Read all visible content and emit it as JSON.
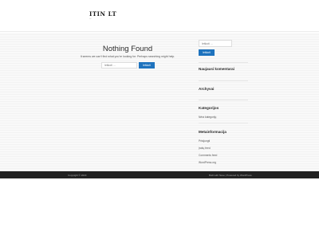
{
  "site": {
    "title": "ITIN LT",
    "tagline": "—"
  },
  "main": {
    "title": "Nothing Found",
    "message": "It seems we can't find what you're looking for. Perhaps searching might help.",
    "search_placeholder": "Ieškoti …",
    "search_button": "Ieškoti"
  },
  "sidebar": {
    "search_placeholder": "Ieškoti …",
    "search_button": "Ieškoti",
    "recent_comments_title": "Naujausi komentarai",
    "archives_title": "Archyvai",
    "categories_title": "Kategorijos",
    "categories": [
      "Nėra kategorijų"
    ],
    "meta_title": "Metainformacija",
    "meta_links": [
      "Prisijungti",
      "Įrašų feed",
      "Comments feed",
      "WordPress.org"
    ]
  },
  "footer": {
    "copyright": "Copyright © 2023",
    "credits": "Built with Neve | Powered by WordPress"
  },
  "colors": {
    "accent": "#1e73be",
    "footer_bg": "#222222",
    "body_bg": "#f6f6f6"
  }
}
